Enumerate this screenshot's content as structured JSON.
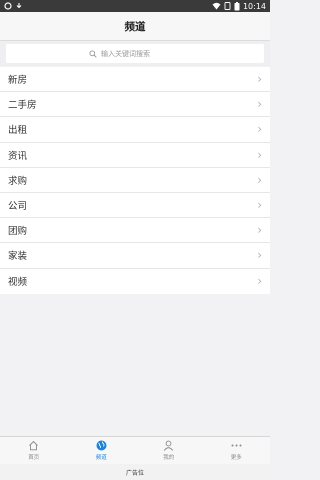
{
  "status_bar": {
    "time": "10:14"
  },
  "header": {
    "title": "频道"
  },
  "search": {
    "placeholder": "输入关键词搜索"
  },
  "channels": [
    {
      "label": "新房"
    },
    {
      "label": "二手房"
    },
    {
      "label": "出租"
    },
    {
      "label": "资讯"
    },
    {
      "label": "求购"
    },
    {
      "label": "公司"
    },
    {
      "label": "团购"
    },
    {
      "label": "家装"
    },
    {
      "label": "视频"
    }
  ],
  "tabbar": {
    "tabs": [
      {
        "label": "首页",
        "icon": "home-icon",
        "active": false
      },
      {
        "label": "频道",
        "icon": "globe-icon",
        "active": true
      },
      {
        "label": "我的",
        "icon": "user-icon",
        "active": false
      },
      {
        "label": "更多",
        "icon": "more-icon",
        "active": false
      }
    ],
    "active_color": "#1a82e2"
  },
  "ad": {
    "label": "广告位"
  }
}
